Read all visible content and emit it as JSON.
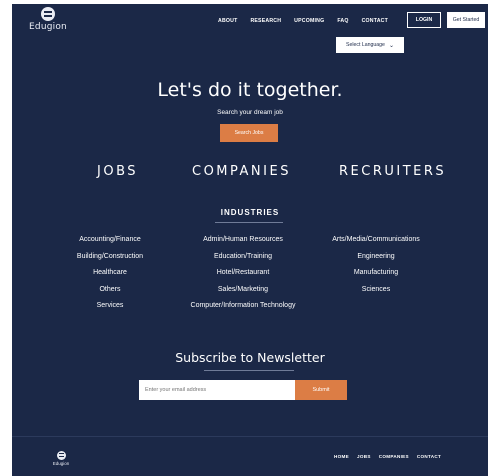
{
  "brand": {
    "name": "Edugion",
    "logo_icon": "book-globe-icon"
  },
  "nav": {
    "links": [
      "ABOUT",
      "RESEARCH",
      "UPCOMING",
      "FAQ",
      "CONTACT"
    ],
    "login_label": "LOGIN",
    "get_started_label": "Get Started"
  },
  "language": {
    "selected": "Select Language",
    "caret_icon": "chevron-down-icon"
  },
  "hero": {
    "title": "Let's do it together.",
    "subtitle": "Search your dream job",
    "search_button": "Search Jobs"
  },
  "categories": {
    "jobs": "JOBS",
    "companies": "COMPANIES",
    "recruiters": "RECRUITERS"
  },
  "industries": {
    "title": "INDUSTRIES",
    "columns": [
      [
        "Accounting/Finance",
        "Building/Construction",
        "Healthcare",
        "Others",
        "Services"
      ],
      [
        "Admin/Human Resources",
        "Education/Training",
        "Hotel/Restaurant",
        "Sales/Marketing",
        "Computer/Information Technology"
      ],
      [
        "Arts/Media/Communications",
        "Engineering",
        "Manufacturing",
        "Sciences"
      ]
    ]
  },
  "newsletter": {
    "title": "Subscribe to Newsletter",
    "email_placeholder": "Enter your email address",
    "submit_label": "Submit"
  },
  "footer": {
    "brand": "Edugion",
    "links": [
      "HOME",
      "JOBS",
      "COMPANIES",
      "CONTACT"
    ]
  },
  "colors": {
    "background": "#1b2847",
    "accent": "#dc7d45",
    "text": "#ffffff"
  }
}
